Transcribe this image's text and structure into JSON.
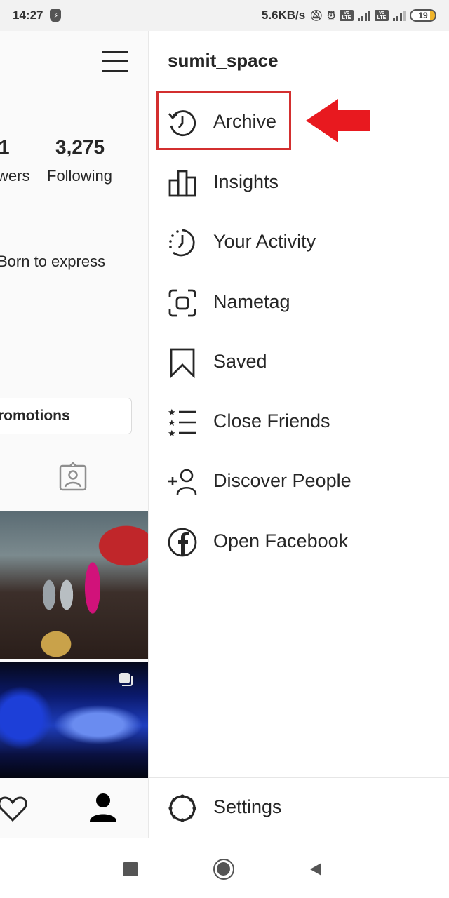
{
  "status_bar": {
    "time": "14:27",
    "network_speed": "5.6KB/s",
    "network_type": "4G",
    "volte_label": "Vo LTE",
    "battery_level": "19",
    "icons": [
      "shield-bolt-icon",
      "bell-off-icon",
      "alarm-icon",
      "volte-icon",
      "signal-icon",
      "volte-icon",
      "signal-icon",
      "battery-icon"
    ]
  },
  "profile": {
    "followers_count_partial": "1",
    "followers_label_partial": "wers",
    "following_count": "3,275",
    "following_label": "Following",
    "bio_partial": "Born to express",
    "promotions_button_partial": "romotions",
    "bottom_nav_icons": [
      "heart-icon",
      "profile-icon"
    ]
  },
  "drawer": {
    "username": "sumit_space",
    "items": [
      {
        "label": "Archive",
        "icon": "archive-clock-icon",
        "highlighted": true
      },
      {
        "label": "Insights",
        "icon": "bar-chart-icon"
      },
      {
        "label": "Your Activity",
        "icon": "activity-clock-icon"
      },
      {
        "label": "Nametag",
        "icon": "nametag-scan-icon"
      },
      {
        "label": "Saved",
        "icon": "bookmark-icon"
      },
      {
        "label": "Close Friends",
        "icon": "star-list-icon"
      },
      {
        "label": "Discover People",
        "icon": "add-person-icon"
      },
      {
        "label": "Open Facebook",
        "icon": "facebook-icon"
      }
    ],
    "settings_label": "Settings"
  },
  "annotation": {
    "highlight_color": "#d32f2f",
    "arrow_color": "#e8191f"
  },
  "android_nav": [
    "recents-button",
    "home-button",
    "back-button"
  ]
}
